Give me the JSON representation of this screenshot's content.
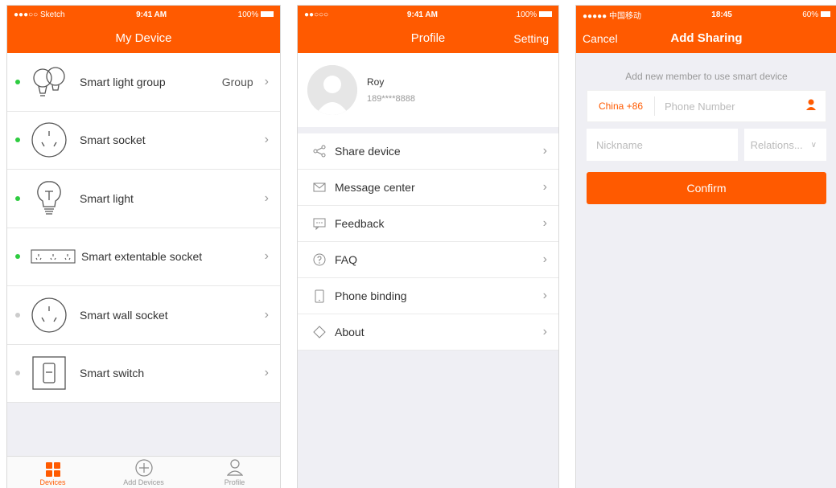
{
  "screen1": {
    "status": {
      "carrier": "●●●○○ Sketch",
      "time": "9:41 AM",
      "battery": "100%"
    },
    "title": "My Device",
    "devices": [
      {
        "label": "Smart light group",
        "extra": "Group",
        "icon": "light-group-icon",
        "status": "online"
      },
      {
        "label": "Smart socket",
        "extra": "",
        "icon": "socket-icon",
        "status": "online"
      },
      {
        "label": "Smart light",
        "extra": "",
        "icon": "bulb-icon",
        "status": "online"
      },
      {
        "label": "Smart extentable socket",
        "extra": "",
        "icon": "power-strip-icon",
        "status": "online"
      },
      {
        "label": "Smart wall socket",
        "extra": "",
        "icon": "wall-socket-icon",
        "status": "offline"
      },
      {
        "label": "Smart switch",
        "extra": "",
        "icon": "switch-icon",
        "status": "offline"
      }
    ],
    "tabs": [
      {
        "label": "Devices",
        "icon": "grid-icon"
      },
      {
        "label": "Add Devices",
        "icon": "plus-circle-icon"
      },
      {
        "label": "Profile",
        "icon": "person-icon"
      }
    ]
  },
  "screen2": {
    "status": {
      "carrier": "●●○○○",
      "time": "9:41 AM",
      "battery": "100%"
    },
    "title": "Profile",
    "setting": "Setting",
    "user": {
      "name": "Roy",
      "phone": "189****8888"
    },
    "menu": [
      {
        "label": "Share device",
        "icon": "share-icon"
      },
      {
        "label": "Message center",
        "icon": "envelope-icon"
      },
      {
        "label": "Feedback",
        "icon": "chat-icon"
      },
      {
        "label": "FAQ",
        "icon": "question-icon"
      },
      {
        "label": "Phone binding",
        "icon": "phone-icon"
      },
      {
        "label": "About",
        "icon": "diamond-icon"
      }
    ]
  },
  "screen3": {
    "status": {
      "carrier": "●●●●● 中国移动",
      "time": "18:45",
      "battery": "60%"
    },
    "cancel": "Cancel",
    "title": "Add Sharing",
    "hint": "Add new member to use smart device",
    "country": "China +86",
    "phone_placeholder": "Phone Number",
    "nickname_placeholder": "Nickname",
    "relations": "Relations...",
    "confirm": "Confirm"
  },
  "colors": {
    "accent": "#ff5a00",
    "online": "#2ecc40",
    "offline": "#cccccc"
  }
}
